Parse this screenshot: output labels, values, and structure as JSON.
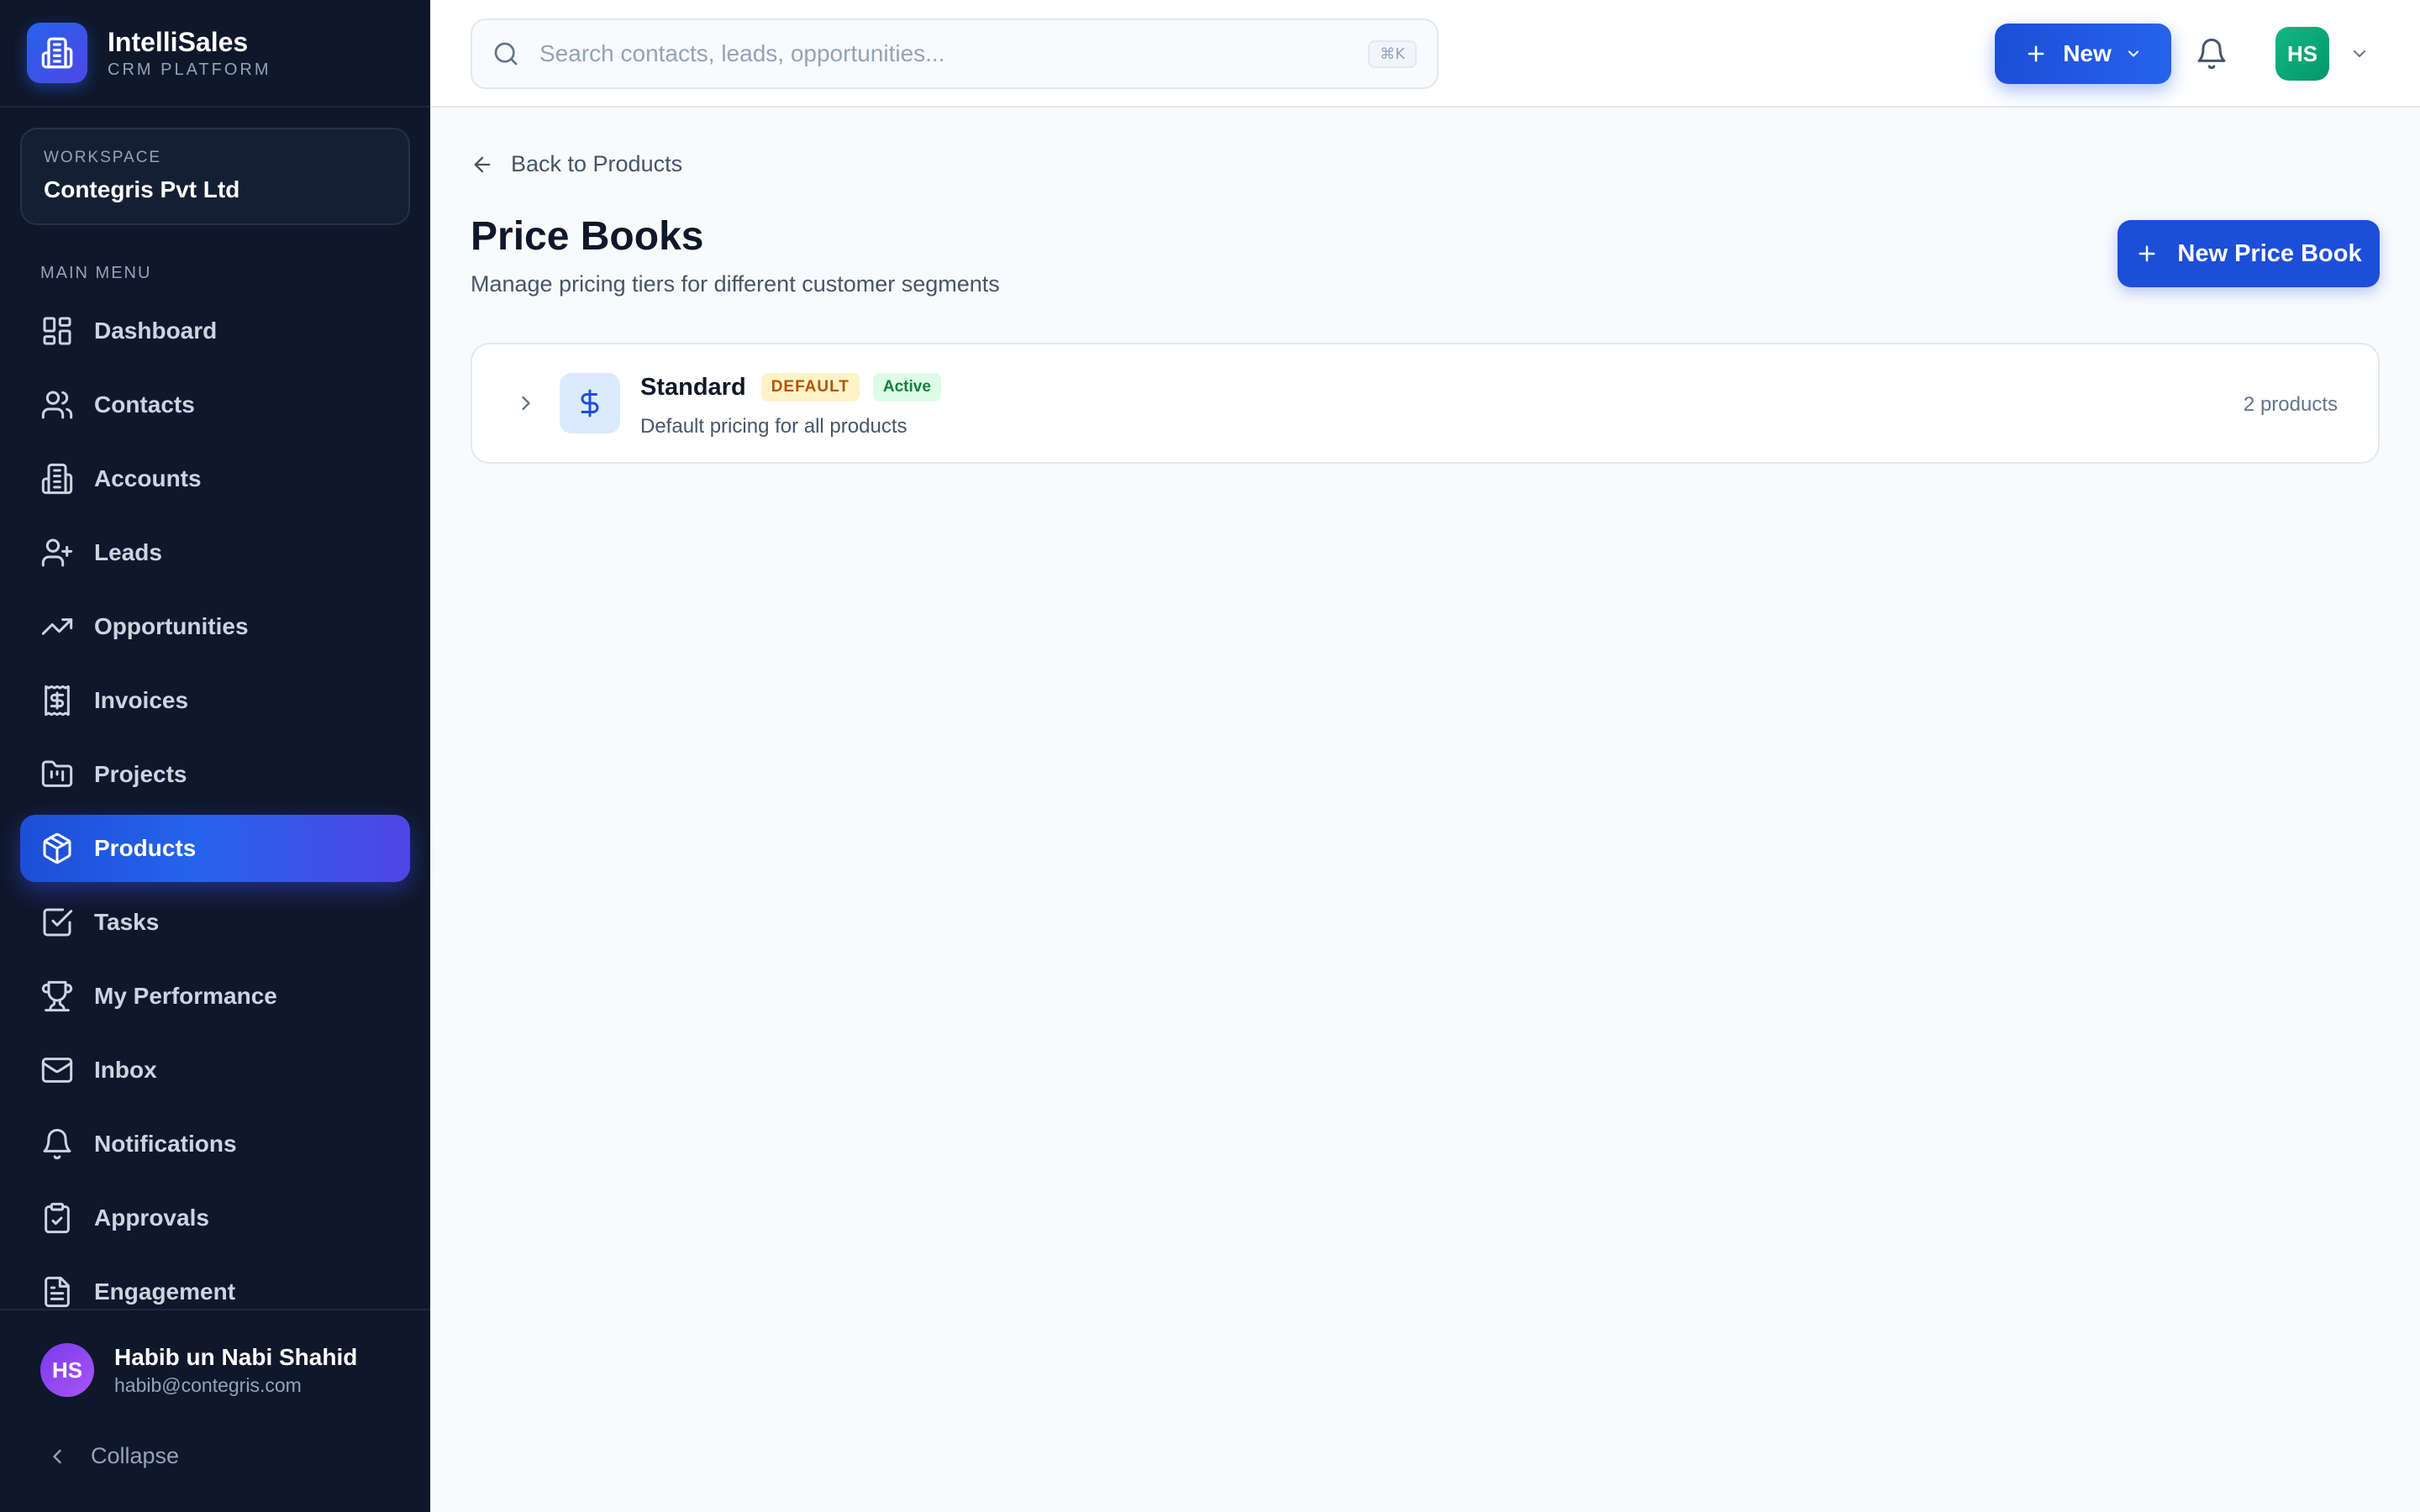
{
  "brand": {
    "name": "IntelliSales",
    "subtitle": "CRM PLATFORM"
  },
  "workspace": {
    "label": "WORKSPACE",
    "name": "Contegris Pvt Ltd"
  },
  "sidebar": {
    "menu_label": "MAIN MENU",
    "items": [
      {
        "label": "Dashboard",
        "icon": "dashboard-icon"
      },
      {
        "label": "Contacts",
        "icon": "users-icon"
      },
      {
        "label": "Accounts",
        "icon": "building-icon"
      },
      {
        "label": "Leads",
        "icon": "user-plus-icon"
      },
      {
        "label": "Opportunities",
        "icon": "trending-up-icon"
      },
      {
        "label": "Invoices",
        "icon": "receipt-icon"
      },
      {
        "label": "Projects",
        "icon": "folder-icon"
      },
      {
        "label": "Products",
        "icon": "package-icon",
        "active": true
      },
      {
        "label": "Tasks",
        "icon": "check-square-icon"
      },
      {
        "label": "My Performance",
        "icon": "trophy-icon"
      },
      {
        "label": "Inbox",
        "icon": "mail-icon"
      },
      {
        "label": "Notifications",
        "icon": "bell-icon"
      },
      {
        "label": "Approvals",
        "icon": "clipboard-check-icon"
      },
      {
        "label": "Engagement",
        "icon": "document-icon"
      }
    ]
  },
  "user": {
    "initials": "HS",
    "name": "Habib un Nabi Shahid",
    "email": "habib@contegris.com"
  },
  "collapse_label": "Collapse",
  "topbar": {
    "search_placeholder": "Search contacts, leads, opportunities...",
    "shortcut": "⌘K",
    "new_label": "New",
    "avatar_initials": "HS"
  },
  "page": {
    "back_label": "Back to Products",
    "title": "Price Books",
    "subtitle": "Manage pricing tiers for different customer segments",
    "new_button_label": "New Price Book"
  },
  "price_books": [
    {
      "name": "Standard",
      "badge_default": "DEFAULT",
      "badge_status": "Active",
      "description": "Default pricing for all products",
      "count": "2 products"
    }
  ],
  "colors": {
    "sidebar_bg": "#0f172a",
    "accent": "#1d4ed8",
    "active_gradient_end": "#4f46e5",
    "badge_default_bg": "#fef3c7",
    "badge_active_bg": "#dcfce7"
  }
}
